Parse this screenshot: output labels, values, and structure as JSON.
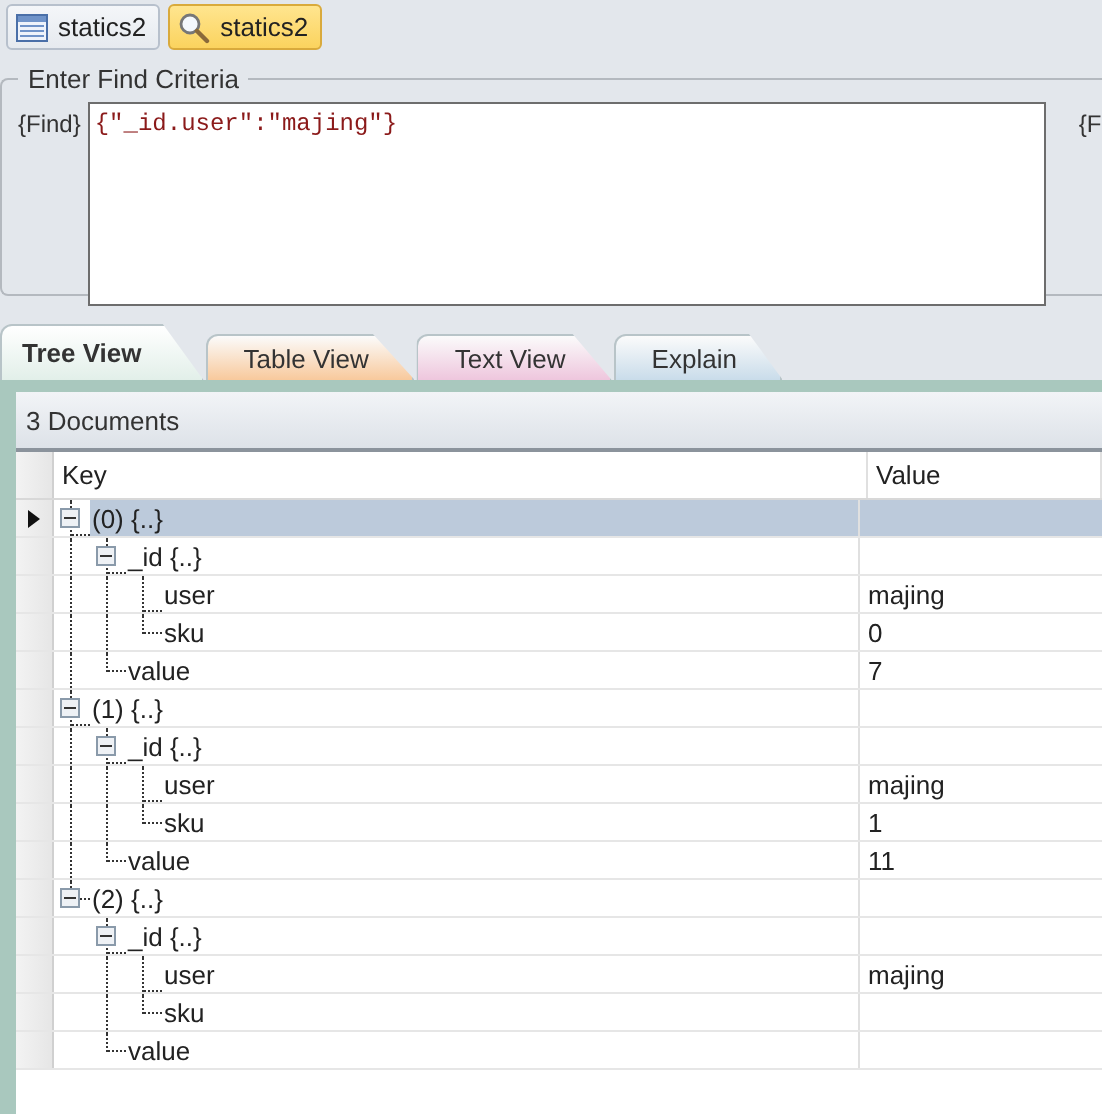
{
  "query_tabs": [
    {
      "label": "statics2",
      "kind": "table",
      "selected": false
    },
    {
      "label": "statics2",
      "kind": "search",
      "selected": true
    }
  ],
  "find_criteria": {
    "title": "Enter Find Criteria",
    "find_label": "{Find}",
    "find_value": "{\"_id.user\":\"majing\"}",
    "cut_label": "{F"
  },
  "view_tabs": [
    {
      "label": "Tree View",
      "selected": true,
      "color": "#e2efe9"
    },
    {
      "label": "Table View",
      "selected": false,
      "color": "#f8c99c"
    },
    {
      "label": "Text View",
      "selected": false,
      "color": "#eec6dd"
    },
    {
      "label": "Explain",
      "selected": false,
      "color": "#c9dcea"
    }
  ],
  "results": {
    "count": "3 Documents",
    "columns": [
      "Key",
      "Value"
    ],
    "tree": [
      {
        "key": "(0) {..}",
        "selected": true,
        "expanded": true,
        "children": [
          {
            "key": "_id {..}",
            "selected": false,
            "expanded": true,
            "children": [
              {
                "key": "user",
                "value": "majing",
                "selected": false
              },
              {
                "key": "sku",
                "value": "0",
                "selected": false
              }
            ]
          },
          {
            "key": "value",
            "value": "7",
            "selected": false
          }
        ]
      },
      {
        "key": "(1) {..}",
        "selected": false,
        "expanded": true,
        "children": [
          {
            "key": "_id {..}",
            "selected": false,
            "expanded": true,
            "children": [
              {
                "key": "user",
                "value": "majing",
                "selected": false
              },
              {
                "key": "sku",
                "value": "1",
                "selected": false
              }
            ]
          },
          {
            "key": "value",
            "value": "11",
            "selected": false
          }
        ]
      },
      {
        "key": "(2) {..}",
        "selected": false,
        "expanded": true,
        "children": [
          {
            "key": "_id {..}",
            "selected": false,
            "expanded": true,
            "children": [
              {
                "key": "user",
                "value": "majing",
                "selected": false
              },
              {
                "key": "sku",
                "selected": false
              }
            ]
          },
          {
            "key": "value",
            "selected": false
          }
        ]
      }
    ]
  }
}
